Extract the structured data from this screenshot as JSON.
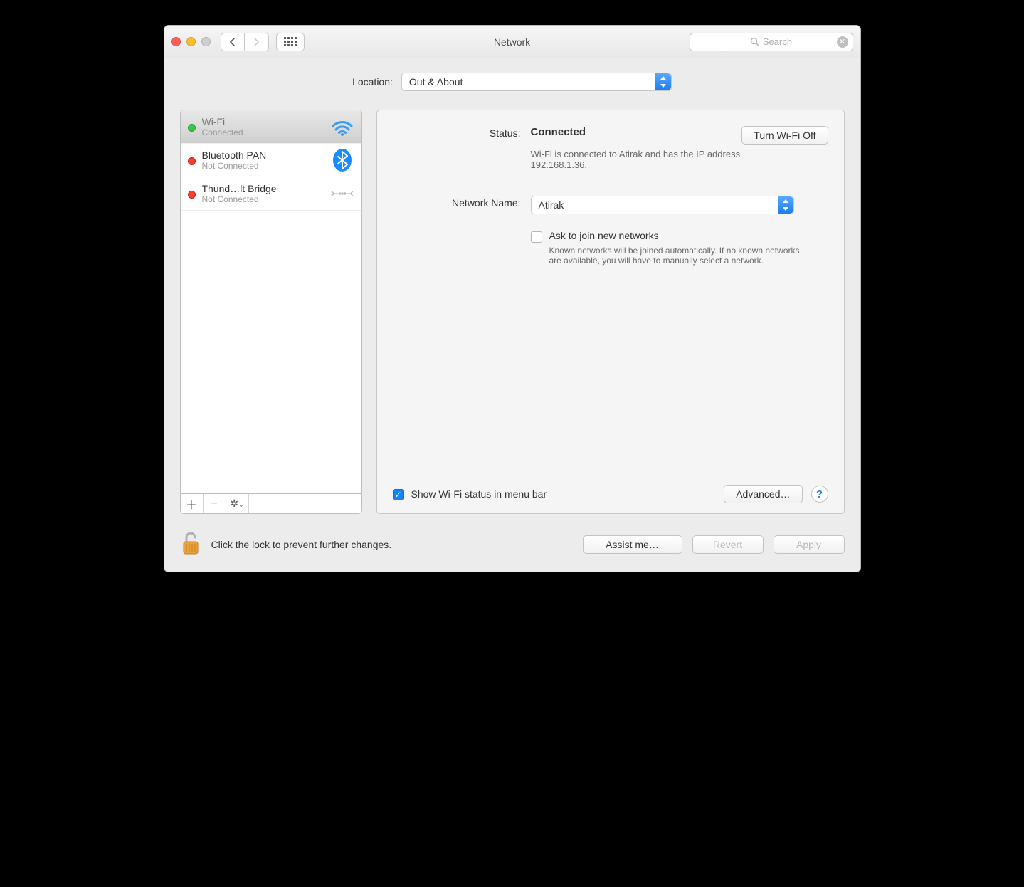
{
  "window": {
    "title": "Network"
  },
  "search": {
    "placeholder": "Search"
  },
  "location": {
    "label": "Location:",
    "value": "Out & About"
  },
  "sidebar": {
    "items": [
      {
        "name": "Wi-Fi",
        "status": "Connected",
        "dot": "green",
        "icon": "wifi"
      },
      {
        "name": "Bluetooth PAN",
        "status": "Not Connected",
        "dot": "red",
        "icon": "bluetooth"
      },
      {
        "name": "Thund…lt Bridge",
        "status": "Not Connected",
        "dot": "red",
        "icon": "thunderbolt"
      }
    ]
  },
  "detail": {
    "status_label": "Status:",
    "status_value": "Connected",
    "wifi_off_btn": "Turn Wi-Fi Off",
    "status_desc": "Wi-Fi is connected to Atirak and has the IP address 192.168.1.36.",
    "network_name_label": "Network Name:",
    "network_name_value": "Atirak",
    "ask_join_label": "Ask to join new networks",
    "ask_join_desc": "Known networks will be joined automatically. If no known networks are available, you will have to manually select a network.",
    "show_status_label": "Show Wi-Fi status in menu bar",
    "advanced_btn": "Advanced…"
  },
  "footer": {
    "lock_text": "Click the lock to prevent further changes.",
    "assist_btn": "Assist me…",
    "revert_btn": "Revert",
    "apply_btn": "Apply"
  }
}
